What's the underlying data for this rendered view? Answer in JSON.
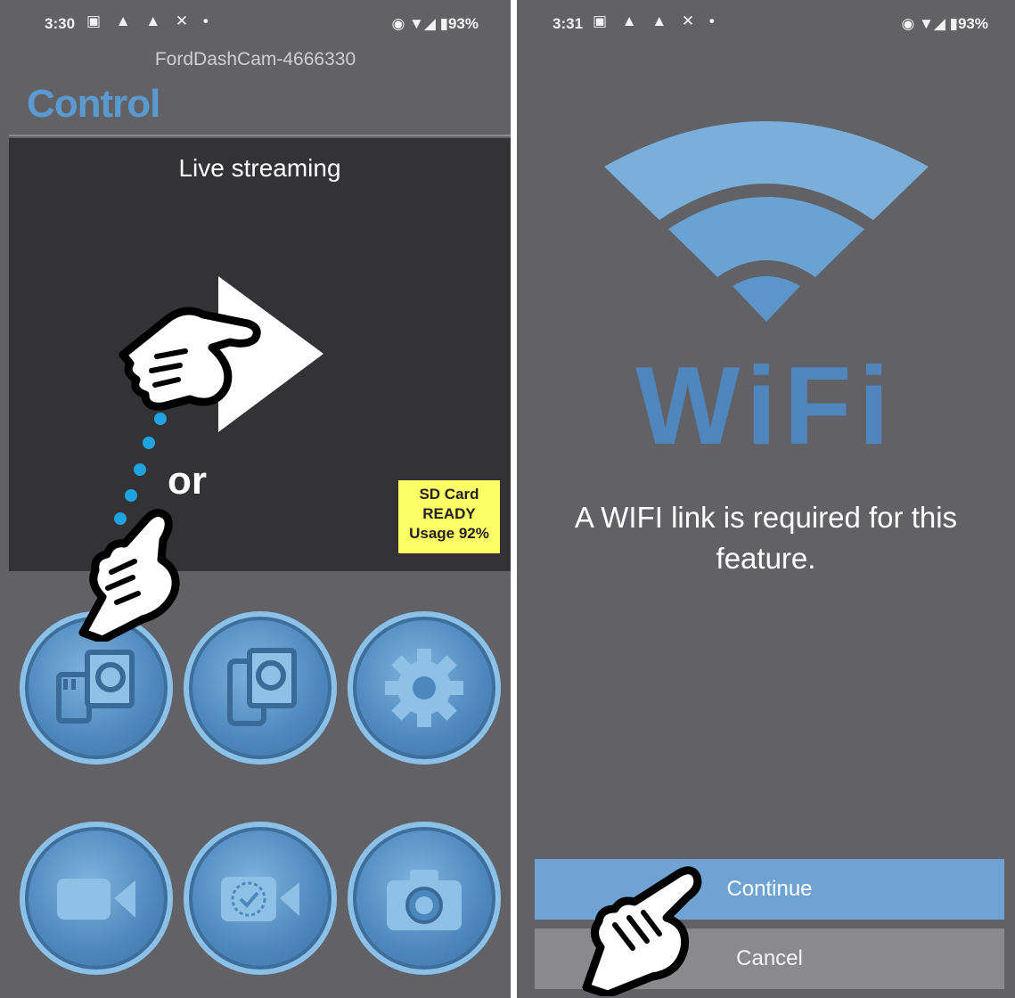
{
  "left_screen": {
    "status_bar": {
      "time": "3:30",
      "left_icons": "▣ ▲ ▲ ✕ •",
      "right_icons": "◉ ▼◢ ▮93%"
    },
    "device_name": "FordDashCam-4666330",
    "title": "Control",
    "stream": {
      "label": "Live streaming",
      "play_icon": "play-icon"
    },
    "sd_card": {
      "line1": "SD Card",
      "line2": "READY",
      "line3": "Usage 92%"
    },
    "hint_text": "or",
    "tiles": [
      {
        "name": "sd-card-gallery",
        "icon": "sd-card-photo-icon"
      },
      {
        "name": "phone-gallery",
        "icon": "phone-photo-icon"
      },
      {
        "name": "settings",
        "icon": "gear-icon"
      },
      {
        "name": "record-video",
        "icon": "video-camera-icon"
      },
      {
        "name": "timelapse-video",
        "icon": "timelapse-video-icon"
      },
      {
        "name": "take-photo",
        "icon": "camera-icon"
      }
    ],
    "colors": {
      "title": "#5a9ad0",
      "panel": "#333335",
      "badge": "#ffff66",
      "tile": "#4c87bd",
      "dots": "#1fa3e0"
    }
  },
  "right_screen": {
    "status_bar": {
      "time": "3:31",
      "left_icons": "▣ ▲ ▲ ✕ •",
      "right_icons": "◉ ▼◢ ▮93%"
    },
    "wifi_word": "WiFi",
    "message": "A WIFI link is required for this feature.",
    "buttons": {
      "continue": "Continue",
      "cancel": "Cancel"
    },
    "colors": {
      "wifi": "#4f86bd",
      "continue": "#6fa3d3",
      "cancel": "#8a8a8e"
    }
  }
}
